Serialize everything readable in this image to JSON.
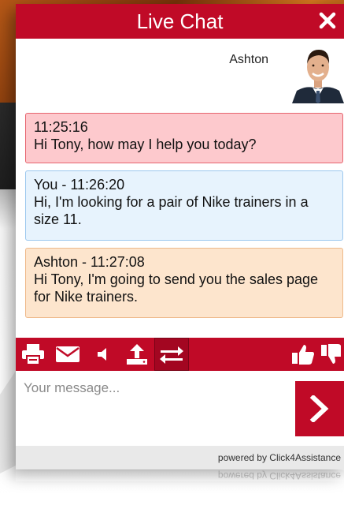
{
  "header": {
    "title": "Live Chat",
    "close_icon": "close-icon"
  },
  "agent": {
    "name": "Ashton",
    "avatar_icon": "agent-avatar"
  },
  "messages": [
    {
      "sender": "agent-first",
      "meta": "11:25:16",
      "text": "Hi Tony, how may I help you today?"
    },
    {
      "sender": "you",
      "meta": "You - 11:26:20",
      "text": "Hi, I'm looking for a pair of Nike trainers in a size 11."
    },
    {
      "sender": "agent",
      "meta": "Ashton - 11:27:08",
      "text": "Hi Tony, I'm going to send you the sales page for Nike trainers."
    }
  ],
  "toolbar": {
    "icons": [
      "print-icon",
      "email-icon",
      "sound-icon",
      "upload-icon",
      "transfer-icon",
      "thumbs-up-icon",
      "thumbs-down-icon"
    ]
  },
  "input": {
    "placeholder": "Your message...",
    "value": ""
  },
  "send": {
    "icon": "chevron-right-icon"
  },
  "footer": {
    "powered_by": "powered by Click4Assistance"
  },
  "colors": {
    "brand": "#c00a27",
    "agent_first_bg": "#fdc9cd",
    "you_bg": "#e7f3fd",
    "agent_bg": "#fde5cd"
  }
}
